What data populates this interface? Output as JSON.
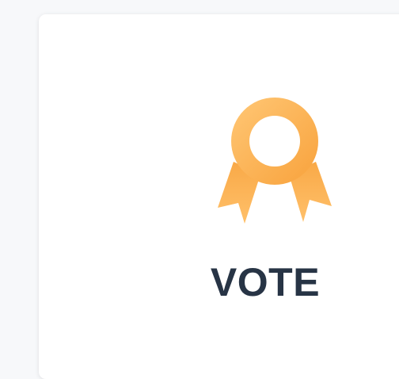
{
  "card": {
    "icon": "award-ribbon-icon",
    "title": "VOTE"
  },
  "colors": {
    "icon_light": "#ffc46e",
    "icon_dark": "#f9a640",
    "title": "#273445",
    "background": "#f7f8fa",
    "card": "#ffffff"
  }
}
